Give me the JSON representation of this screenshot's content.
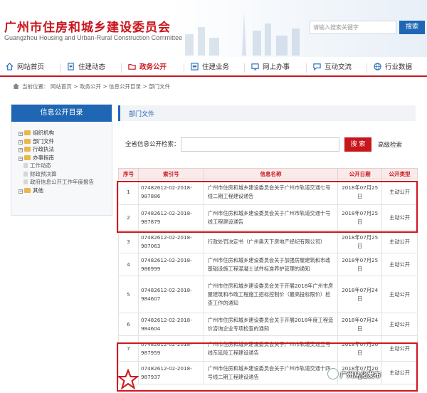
{
  "header": {
    "title": "广州市住房和城乡建设委员会",
    "subtitle": "Guangzhou Housing and Urban-Rural Construction Committee",
    "search_placeholder": "请输入搜索关键字",
    "search_label": "搜索"
  },
  "nav": [
    {
      "label": "网站首页",
      "icon": "home-icon"
    },
    {
      "label": "住建动态",
      "icon": "document-icon"
    },
    {
      "label": "政务公开",
      "icon": "folder-icon"
    },
    {
      "label": "住建业务",
      "icon": "list-icon"
    },
    {
      "label": "网上办事",
      "icon": "monitor-icon"
    },
    {
      "label": "互动交流",
      "icon": "chat-icon"
    },
    {
      "label": "行业数据",
      "icon": "globe-icon"
    }
  ],
  "nav_active": "政务公开",
  "breadcrumb": "当前位置： 网站首页 > 政务公开 > 信息公开目录 > 部门文件",
  "sidebar": {
    "title": "信息公开目录",
    "items": [
      {
        "label": "组织机构",
        "type": "folder"
      },
      {
        "label": "部门文件",
        "type": "folder"
      },
      {
        "label": "行政执法",
        "type": "folder"
      },
      {
        "label": "办事指南",
        "type": "folder"
      },
      {
        "label": "工作动态",
        "type": "doc"
      },
      {
        "label": "财政预决算",
        "type": "doc"
      },
      {
        "label": "政府信息公开工作年度报告",
        "type": "doc"
      },
      {
        "label": "其他",
        "type": "folder"
      }
    ]
  },
  "main": {
    "tab": "部门文件",
    "search_label": "全省信息公开检索：",
    "search_button": "搜 索",
    "advanced": "高级检索",
    "columns": [
      "序号",
      "索引号",
      "信息名称",
      "公开日期",
      "公开类型"
    ],
    "rows": [
      {
        "no": "1",
        "index": "07482612-02-2018-987886",
        "title": "广州市住房和城乡建设委员会关于广州市轨道交通七号线二期工程建设通告",
        "date": "2018年07月25日",
        "type": "主动公开"
      },
      {
        "no": "2",
        "index": "07482612-02-2018-987879",
        "title": "广州市住房和城乡建设委员会关于广州市轨道交通十号线工程建设通告",
        "date": "2018年07月25日",
        "type": "主动公开"
      },
      {
        "no": "3",
        "index": "07482612-02-2018-987063",
        "title": "行政处罚决定书（广州奥天下房地产经纪有限公司）",
        "date": "2018年07月25日",
        "type": "主动公开"
      },
      {
        "no": "4",
        "index": "07482612-02-2018-986999",
        "title": "广州市住房和城乡建设委员会关于加强房屋建筑和市政基础设施工程混凝土试件标准养护管理的通知",
        "date": "2018年07月25日",
        "type": "主动公开"
      },
      {
        "no": "5",
        "index": "07482612-02-2018-984607",
        "title": "广州市住房和城乡建设委员会关于开展2018年广州市房屋建筑和市政工程施工招标控制价（最高投标限价）检查工作的通知",
        "date": "2018年07月24日",
        "type": "主动公开"
      },
      {
        "no": "6",
        "index": "07482612-02-2018-984604",
        "title": "广州市住房和城乡建设委员会关于开展2018年度工程造价咨询企业专项检查的通知",
        "date": "2018年07月24日",
        "type": "主动公开"
      },
      {
        "no": "7",
        "index": "07482612-02-2018-987959",
        "title": "广州市住房和城乡建设委员会关于广州市轨道交通五号线东延段工程建设通告",
        "date": "2018年07月20日",
        "type": "主动公开"
      },
      {
        "no": "8",
        "index": "07482612-02-2018-987937",
        "title": "广州市住房和城乡建设委员会关于广州市轨道交通十四号线二期工程建设通告",
        "date": "2018年07月20日",
        "type": "主动公开"
      }
    ]
  },
  "watermark": "广州从化发布",
  "colors": {
    "brand_red": "#c8161d",
    "brand_blue": "#1f67b4",
    "highlight_box": "#d0161e"
  }
}
